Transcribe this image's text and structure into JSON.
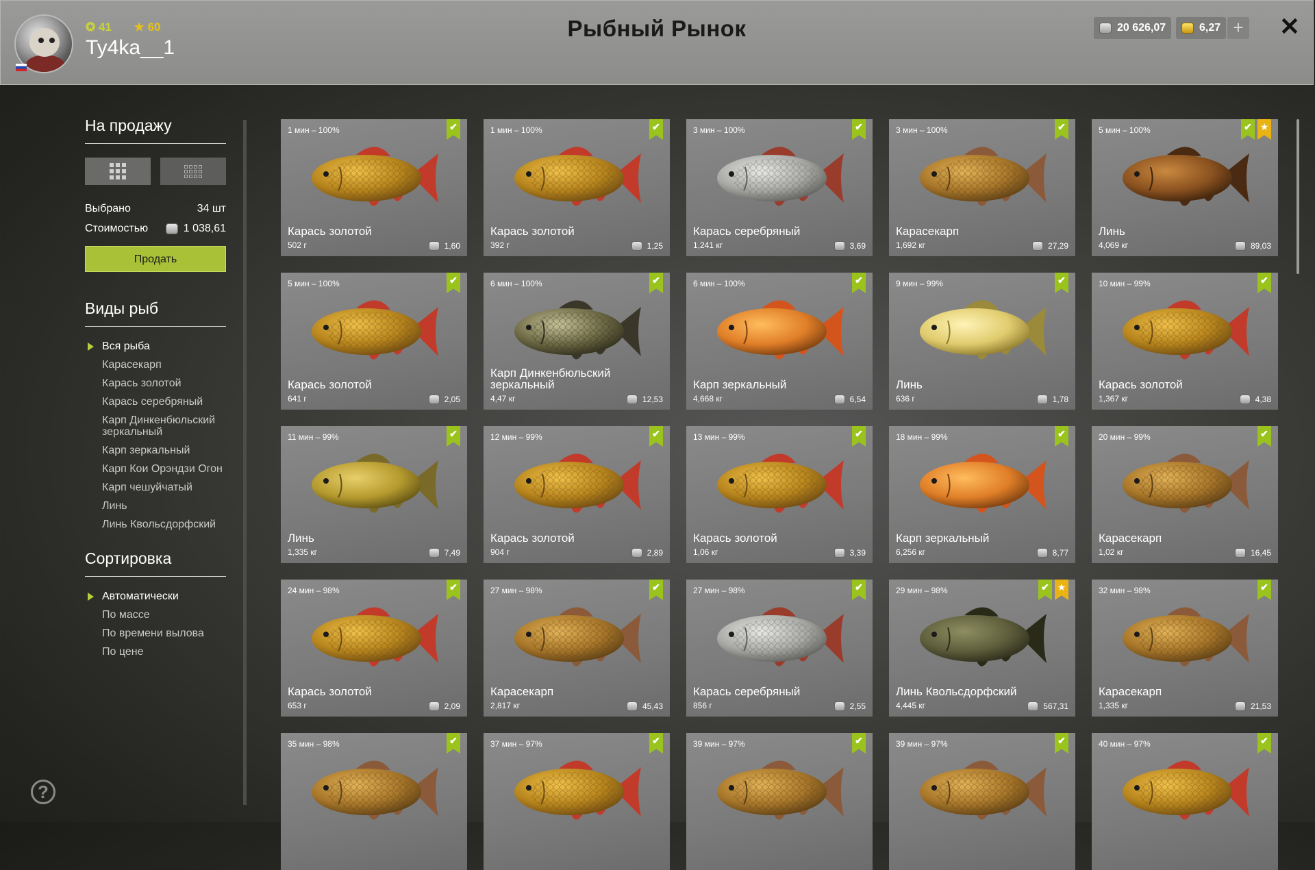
{
  "header": {
    "title": "Рыбный Рынок",
    "level": "41",
    "rank": "60",
    "username": "Ty4ka__1",
    "silver": "20 626,07",
    "gold": "6,27",
    "plus_icon": "+",
    "close_icon": "✕"
  },
  "sidebar": {
    "for_sale_title": "На продажу",
    "selected_label": "Выбрано",
    "selected_value": "34 шт",
    "cost_label": "Стоимостью",
    "cost_value": "1 038,61",
    "sell_button": "Продать",
    "species_title": "Виды рыб",
    "species": [
      "Вся рыба",
      "Карасекарп",
      "Карась золотой",
      "Карась серебряный",
      "Карп Динкенбюльский зеркальный",
      "Карп зеркальный",
      "Карп Кои Орэндзи Огон",
      "Карп чешуйчатый",
      "Линь",
      "Линь Квольсдорфский"
    ],
    "sort_title": "Сортировка",
    "sort_options": [
      "Автоматически",
      "По массе",
      "По времени вылова",
      "По цене"
    ]
  },
  "fish_cards": [
    {
      "time": "1 мин – 100%",
      "name": "Карась золотой",
      "weight": "502 г",
      "price": "1,60",
      "kind": "gold",
      "star": false
    },
    {
      "time": "1 мин – 100%",
      "name": "Карась золотой",
      "weight": "392 г",
      "price": "1,25",
      "kind": "gold",
      "star": false
    },
    {
      "time": "3 мин – 100%",
      "name": "Карась серебряный",
      "weight": "1,241 кг",
      "price": "3,69",
      "kind": "silver",
      "star": false
    },
    {
      "time": "3 мин – 100%",
      "name": "Карасекарп",
      "weight": "1,692 кг",
      "price": "27,29",
      "kind": "hybrid",
      "star": false
    },
    {
      "time": "5 мин – 100%",
      "name": "Линь",
      "weight": "4,069 кг",
      "price": "89,03",
      "kind": "tenchbrown",
      "star": true
    },
    {
      "time": "5 мин – 100%",
      "name": "Карась золотой",
      "weight": "641 г",
      "price": "2,05",
      "kind": "gold",
      "star": false
    },
    {
      "time": "6 мин – 100%",
      "name": "Карп Динкенбюльский зеркальный",
      "weight": "4,47 кг",
      "price": "12,53",
      "kind": "dinken",
      "star": false
    },
    {
      "time": "6 мин – 100%",
      "name": "Карп зеркальный",
      "weight": "4,668 кг",
      "price": "6,54",
      "kind": "mirror",
      "star": false
    },
    {
      "time": "9 мин – 99%",
      "name": "Линь",
      "weight": "636 г",
      "price": "1,78",
      "kind": "tenchpale",
      "star": false
    },
    {
      "time": "10 мин – 99%",
      "name": "Карась золотой",
      "weight": "1,367 кг",
      "price": "4,38",
      "kind": "gold",
      "star": false
    },
    {
      "time": "11 мин – 99%",
      "name": "Линь",
      "weight": "1,335 кг",
      "price": "7,49",
      "kind": "tench",
      "star": false
    },
    {
      "time": "12 мин – 99%",
      "name": "Карась золотой",
      "weight": "904 г",
      "price": "2,89",
      "kind": "gold",
      "star": false
    },
    {
      "time": "13 мин – 99%",
      "name": "Карась золотой",
      "weight": "1,06 кг",
      "price": "3,39",
      "kind": "gold",
      "star": false
    },
    {
      "time": "18 мин – 99%",
      "name": "Карп зеркальный",
      "weight": "6,256 кг",
      "price": "8,77",
      "kind": "mirror",
      "star": false
    },
    {
      "time": "20 мин – 99%",
      "name": "Карасекарп",
      "weight": "1,02 кг",
      "price": "16,45",
      "kind": "hybrid",
      "star": false
    },
    {
      "time": "24 мин – 98%",
      "name": "Карась золотой",
      "weight": "653 г",
      "price": "2,09",
      "kind": "gold",
      "star": false
    },
    {
      "time": "27 мин – 98%",
      "name": "Карасекарп",
      "weight": "2,817 кг",
      "price": "45,43",
      "kind": "hybrid",
      "star": false
    },
    {
      "time": "27 мин – 98%",
      "name": "Карась серебряный",
      "weight": "856 г",
      "price": "2,55",
      "kind": "silver",
      "star": false
    },
    {
      "time": "29 мин – 98%",
      "name": "Линь Квольсдорфский",
      "weight": "4,445 кг",
      "price": "567,31",
      "kind": "tenchdark",
      "star": true
    },
    {
      "time": "32 мин – 98%",
      "name": "Карасекарп",
      "weight": "1,335 кг",
      "price": "21,53",
      "kind": "hybrid",
      "star": false
    },
    {
      "time": "35 мин – 98%",
      "name": "",
      "weight": "",
      "price": "",
      "kind": "hybrid",
      "star": false
    },
    {
      "time": "37 мин – 97%",
      "name": "",
      "weight": "",
      "price": "",
      "kind": "gold",
      "star": false
    },
    {
      "time": "39 мин – 97%",
      "name": "",
      "weight": "",
      "price": "",
      "kind": "hybrid",
      "star": false
    },
    {
      "time": "39 мин – 97%",
      "name": "",
      "weight": "",
      "price": "",
      "kind": "hybrid",
      "star": false
    },
    {
      "time": "40 мин – 97%",
      "name": "",
      "weight": "",
      "price": "",
      "kind": "gold",
      "star": false
    }
  ],
  "icons": {
    "check": "✔",
    "star": "★",
    "help": "?",
    "view_large": "grid-large-icon",
    "view_small": "grid-small-icon"
  },
  "colors": {
    "accent_green": "#a9c136",
    "check_flag": "#9bc31e",
    "star_flag": "#e8b313",
    "level": "#c9d33a",
    "rank": "#e6c21a"
  }
}
